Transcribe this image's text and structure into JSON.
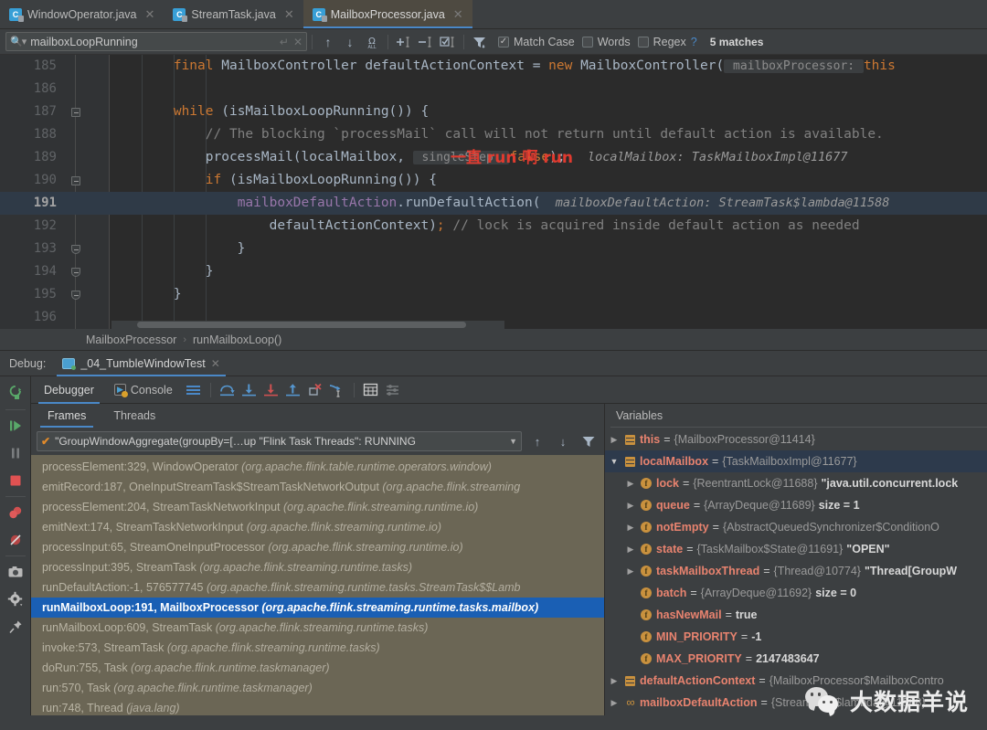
{
  "tabs": [
    {
      "label": "WindowOperator.java",
      "active": false
    },
    {
      "label": "StreamTask.java",
      "active": false
    },
    {
      "label": "MailboxProcessor.java",
      "active": true
    }
  ],
  "find": {
    "query": "mailboxLoopRunning",
    "placeholder": "Search",
    "match_case_label": "Match Case",
    "match_case_checked": "✓",
    "words_label": "Words",
    "regex_label": "Regex",
    "help_label": "?",
    "matches_label": "5 matches",
    "prev_icon": "↑",
    "next_icon": "↓",
    "select_all_icon": "Ω",
    "add_icon": "+",
    "remove_icon": "−",
    "select_icon": "☑",
    "filter_icon": "▼",
    "wrap_icon": "↵",
    "close_icon": "✕"
  },
  "editor": {
    "annotation": "一直 run 啊 run",
    "lines": [
      {
        "n": "185",
        "fold": "",
        "segments": [
          {
            "t": "        ",
            "c": "plain"
          },
          {
            "t": "final ",
            "c": "kw"
          },
          {
            "t": "MailboxController defaultActionContext = ",
            "c": "plain"
          },
          {
            "t": "new ",
            "c": "kw"
          },
          {
            "t": "MailboxController(",
            "c": "plain"
          },
          {
            "t": " mailboxProcessor: ",
            "c": "hint"
          },
          {
            "t": "this",
            "c": "kw"
          }
        ]
      },
      {
        "n": "186",
        "fold": "",
        "segments": []
      },
      {
        "n": "187",
        "fold": "start",
        "segments": [
          {
            "t": "        ",
            "c": "plain"
          },
          {
            "t": "while ",
            "c": "kw"
          },
          {
            "t": "(isMailboxLoopRunning()) {",
            "c": "plain"
          }
        ]
      },
      {
        "n": "188",
        "fold": "",
        "segments": [
          {
            "t": "            // The blocking `processMail` call will not return until default action is available.",
            "c": "cm"
          }
        ]
      },
      {
        "n": "189",
        "fold": "",
        "segments": [
          {
            "t": "            processMail(localMailbox, ",
            "c": "plain"
          },
          {
            "t": " singleStep: ",
            "c": "hint"
          },
          {
            "t": "false",
            "c": "kw"
          },
          {
            "t": ");",
            "c": "plain"
          },
          {
            "t": "   localMailbox: TaskMailboxImpl@11677",
            "c": "hintv"
          }
        ]
      },
      {
        "n": "190",
        "fold": "start",
        "segments": [
          {
            "t": "            ",
            "c": "plain"
          },
          {
            "t": "if ",
            "c": "kw"
          },
          {
            "t": "(isMailboxLoopRunning()) {",
            "c": "plain"
          }
        ]
      },
      {
        "n": "191",
        "fold": "",
        "highlight": true,
        "segments": [
          {
            "t": "                ",
            "c": "plain"
          },
          {
            "t": "mailboxDefaultAction",
            "c": "fld"
          },
          {
            "t": ".runDefaultAction(",
            "c": "plain"
          },
          {
            "t": "  mailboxDefaultAction: StreamTask$lambda@11588",
            "c": "hintv"
          }
        ]
      },
      {
        "n": "192",
        "fold": "",
        "segments": [
          {
            "t": "                    defaultActionContext)",
            "c": "plain"
          },
          {
            "t": ";",
            "c": "kw"
          },
          {
            "t": " // lock is acquired inside default action as needed",
            "c": "cm"
          }
        ]
      },
      {
        "n": "193",
        "fold": "end",
        "segments": [
          {
            "t": "                }",
            "c": "plain"
          }
        ]
      },
      {
        "n": "194",
        "fold": "end",
        "segments": [
          {
            "t": "            }",
            "c": "plain"
          }
        ]
      },
      {
        "n": "195",
        "fold": "end",
        "segments": [
          {
            "t": "        }",
            "c": "plain"
          }
        ]
      },
      {
        "n": "196",
        "fold": "",
        "segments": []
      }
    ]
  },
  "breadcrumb": {
    "class": "MailboxProcessor",
    "separator": "›",
    "method": "runMailboxLoop()"
  },
  "debug": {
    "label": "Debug:",
    "session_name": "_04_TumbleWindowTest",
    "close_icon": "✕",
    "toolbar_tabs": [
      {
        "label": "Debugger",
        "selected": true
      },
      {
        "label": "Console",
        "selected": false
      }
    ],
    "toolbar_icons": [
      "layout-icon",
      "step-over-icon",
      "step-into-icon",
      "force-step-into-icon",
      "step-out-icon",
      "drop-frame-icon",
      "run-to-cursor-icon",
      "evaluate-expression-icon",
      "settings-icon"
    ],
    "rail_icons": [
      "rerun-icon",
      "resume-icon",
      "pause-icon",
      "stop-icon",
      "view-breakpoints-icon",
      "mute-breakpoints-icon",
      "camera-icon",
      "settings-gear-icon",
      "pin-icon"
    ],
    "subtabs": [
      {
        "label": "Frames",
        "selected": true
      },
      {
        "label": "Threads",
        "selected": false
      }
    ],
    "thread_selector": "\"GroupWindowAggregate(groupBy=[…up \"Flink Task Threads\": RUNNING",
    "thread_ok_icon": "✔",
    "frames": [
      {
        "method": "processElement:329, WindowOperator",
        "pkg": "(org.apache.flink.table.runtime.operators.window)",
        "selected": false
      },
      {
        "method": "emitRecord:187, OneInputStreamTask$StreamTaskNetworkOutput",
        "pkg": "(org.apache.flink.streaming",
        "selected": false
      },
      {
        "method": "processElement:204, StreamTaskNetworkInput",
        "pkg": "(org.apache.flink.streaming.runtime.io)",
        "selected": false
      },
      {
        "method": "emitNext:174, StreamTaskNetworkInput",
        "pkg": "(org.apache.flink.streaming.runtime.io)",
        "selected": false
      },
      {
        "method": "processInput:65, StreamOneInputProcessor",
        "pkg": "(org.apache.flink.streaming.runtime.io)",
        "selected": false
      },
      {
        "method": "processInput:395, StreamTask",
        "pkg": "(org.apache.flink.streaming.runtime.tasks)",
        "selected": false
      },
      {
        "method": "runDefaultAction:-1, 576577745",
        "pkg": "(org.apache.flink.streaming.runtime.tasks.StreamTask$$Lamb",
        "selected": false
      },
      {
        "method": "runMailboxLoop:191, MailboxProcessor",
        "pkg": "(org.apache.flink.streaming.runtime.tasks.mailbox)",
        "selected": true
      },
      {
        "method": "runMailboxLoop:609, StreamTask",
        "pkg": "(org.apache.flink.streaming.runtime.tasks)",
        "selected": false
      },
      {
        "method": "invoke:573, StreamTask",
        "pkg": "(org.apache.flink.streaming.runtime.tasks)",
        "selected": false
      },
      {
        "method": "doRun:755, Task",
        "pkg": "(org.apache.flink.runtime.taskmanager)",
        "selected": false
      },
      {
        "method": "run:570, Task",
        "pkg": "(org.apache.flink.runtime.taskmanager)",
        "selected": false
      },
      {
        "method": "run:748, Thread",
        "pkg": "(java.lang)",
        "selected": false
      }
    ],
    "variables_title": "Variables",
    "variables": [
      {
        "indent": 0,
        "arrow": "▶",
        "icon": "object",
        "name": "this",
        "eq": " = ",
        "value": "{MailboxProcessor@11414}",
        "extra": "",
        "selected": false
      },
      {
        "indent": 0,
        "arrow": "▼",
        "icon": "object",
        "name": "localMailbox",
        "eq": " = ",
        "value": "{TaskMailboxImpl@11677}",
        "extra": "",
        "selected": true
      },
      {
        "indent": 1,
        "arrow": "▶",
        "icon": "field",
        "name": "lock",
        "eq": " = ",
        "value": "{ReentrantLock@11688}",
        "extra": "\"java.util.concurrent.lock",
        "selected": false
      },
      {
        "indent": 1,
        "arrow": "▶",
        "icon": "field",
        "name": "queue",
        "eq": " = ",
        "value": "{ArrayDeque@11689}",
        "extra": "size = 1",
        "selected": false
      },
      {
        "indent": 1,
        "arrow": "▶",
        "icon": "field",
        "name": "notEmpty",
        "eq": " = ",
        "value": "{AbstractQueuedSynchronizer$ConditionO",
        "extra": "",
        "selected": false
      },
      {
        "indent": 1,
        "arrow": "▶",
        "icon": "field",
        "name": "state",
        "eq": " = ",
        "value": "{TaskMailbox$State@11691}",
        "extra": "\"OPEN\"",
        "selected": false
      },
      {
        "indent": 1,
        "arrow": "▶",
        "icon": "field",
        "name": "taskMailboxThread",
        "eq": " = ",
        "value": "{Thread@10774}",
        "extra": "\"Thread[GroupW",
        "selected": false
      },
      {
        "indent": 1,
        "arrow": "",
        "icon": "field",
        "name": "batch",
        "eq": " = ",
        "value": "{ArrayDeque@11692}",
        "extra": "size = 0",
        "selected": false
      },
      {
        "indent": 1,
        "arrow": "",
        "icon": "field",
        "name": "hasNewMail",
        "eq": " = ",
        "value": "",
        "extra": "true",
        "selected": false
      },
      {
        "indent": 1,
        "arrow": "",
        "icon": "field",
        "name": "MIN_PRIORITY",
        "eq": " = ",
        "value": "",
        "extra": "-1",
        "selected": false
      },
      {
        "indent": 1,
        "arrow": "",
        "icon": "field",
        "name": "MAX_PRIORITY",
        "eq": " = ",
        "value": "",
        "extra": "2147483647",
        "selected": false
      },
      {
        "indent": 0,
        "arrow": "▶",
        "icon": "object",
        "name": "defaultActionContext",
        "eq": " = ",
        "value": "{MailboxProcessor$MailboxContro",
        "extra": "",
        "selected": false
      },
      {
        "indent": 0,
        "arrow": "▶",
        "icon": "lambda",
        "name": "mailboxDefaultAction",
        "eq": " = ",
        "value": "{StreamTask$lambda@11588}",
        "extra": "",
        "selected": false
      }
    ]
  },
  "watermark": {
    "text": "大数据羊说",
    "icon": "wechat-icon"
  },
  "colors": {
    "accent": "#4a88c7",
    "selection": "#1a5fb4",
    "annotation": "#e03a2f",
    "frames_bg": "#6b6655",
    "editor_bg": "#2b2b2b"
  }
}
